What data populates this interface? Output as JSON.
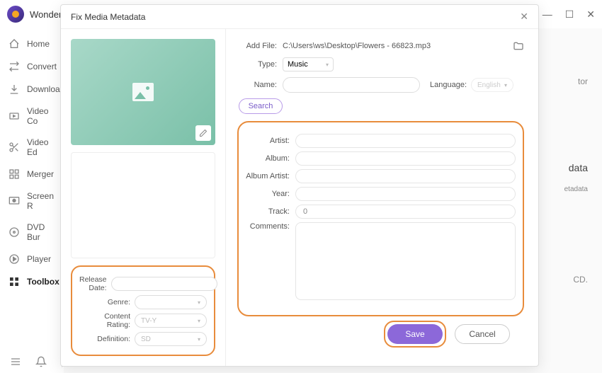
{
  "app": {
    "title": "Wonder"
  },
  "window_controls": {
    "minimize": "—",
    "maximize": "☐",
    "close": "✕"
  },
  "sidebar": {
    "items": [
      {
        "label": "Home"
      },
      {
        "label": "Convert"
      },
      {
        "label": "Downloa"
      },
      {
        "label": "Video Co"
      },
      {
        "label": "Video Ed"
      },
      {
        "label": "Merger"
      },
      {
        "label": "Screen R"
      },
      {
        "label": "DVD Bur"
      },
      {
        "label": "Player"
      },
      {
        "label": "Toolbox"
      }
    ]
  },
  "content_bg": {
    "line1": "tor",
    "line2": "data",
    "line3": "etadata",
    "line4": "CD."
  },
  "modal": {
    "title": "Fix Media Metadata",
    "add_file_label": "Add File:",
    "add_file_path": "C:\\Users\\ws\\Desktop\\Flowers - 66823.mp3",
    "type_label": "Type:",
    "type_value": "Music",
    "name_label": "Name:",
    "language_label": "Language:",
    "language_value": "English",
    "search_label": "Search",
    "artist_label": "Artist:",
    "album_label": "Album:",
    "album_artist_label": "Album Artist:",
    "year_label": "Year:",
    "track_label": "Track:",
    "track_value": "0",
    "comments_label": "Comments:",
    "release_date_label": "Release Date:",
    "genre_label": "Genre:",
    "content_rating_label": "Content Rating:",
    "content_rating_value": "TV-Y",
    "definition_label": "Definition:",
    "definition_value": "SD",
    "save_label": "Save",
    "cancel_label": "Cancel"
  }
}
